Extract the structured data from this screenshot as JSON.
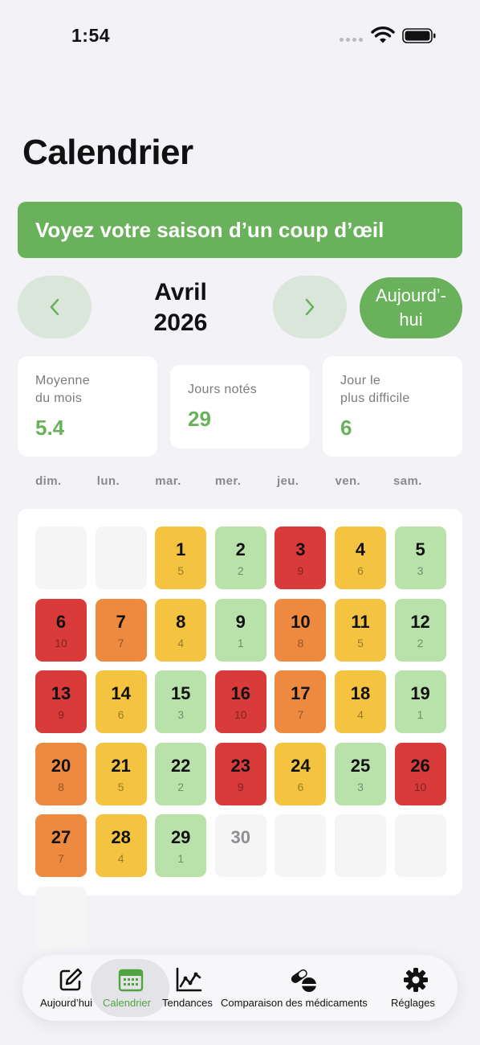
{
  "status": {
    "time": "1:54"
  },
  "title": "Calendrier",
  "banner": "Voyez votre saison d’un coup d’œil",
  "month": {
    "line1": "Avril",
    "line2": "2026"
  },
  "today_button": {
    "line1": "Aujourd’-",
    "line2": "hui"
  },
  "stats": {
    "avg": {
      "label1": "Moyenne",
      "label2": "du mois",
      "value": "5.4"
    },
    "days": {
      "label": "Jours notés",
      "value": "29"
    },
    "hard": {
      "label1": "Jour le",
      "label2": "plus difficile",
      "value": "6"
    }
  },
  "weekdays": [
    "dim.",
    "lun.",
    "mar.",
    "mer.",
    "jeu.",
    "ven.",
    "sam."
  ],
  "colors": {
    "green": "#69b15b",
    "severity_low": "#b9e2ab",
    "severity_mid": "#f4c440",
    "severity_high": "#ee8a3f",
    "severity_max": "#d83b39"
  },
  "calendar": {
    "leading_blanks": 2,
    "days": [
      {
        "day": "1",
        "score": "5",
        "level": "mid"
      },
      {
        "day": "2",
        "score": "2",
        "level": "low"
      },
      {
        "day": "3",
        "score": "9",
        "level": "max"
      },
      {
        "day": "4",
        "score": "6",
        "level": "mid"
      },
      {
        "day": "5",
        "score": "3",
        "level": "low"
      },
      {
        "day": "6",
        "score": "10",
        "level": "max"
      },
      {
        "day": "7",
        "score": "7",
        "level": "high"
      },
      {
        "day": "8",
        "score": "4",
        "level": "mid"
      },
      {
        "day": "9",
        "score": "1",
        "level": "low"
      },
      {
        "day": "10",
        "score": "8",
        "level": "high"
      },
      {
        "day": "11",
        "score": "5",
        "level": "mid"
      },
      {
        "day": "12",
        "score": "2",
        "level": "low"
      },
      {
        "day": "13",
        "score": "9",
        "level": "max"
      },
      {
        "day": "14",
        "score": "6",
        "level": "mid"
      },
      {
        "day": "15",
        "score": "3",
        "level": "low"
      },
      {
        "day": "16",
        "score": "10",
        "level": "max"
      },
      {
        "day": "17",
        "score": "7",
        "level": "high"
      },
      {
        "day": "18",
        "score": "4",
        "level": "mid"
      },
      {
        "day": "19",
        "score": "1",
        "level": "low"
      },
      {
        "day": "20",
        "score": "8",
        "level": "high"
      },
      {
        "day": "21",
        "score": "5",
        "level": "mid"
      },
      {
        "day": "22",
        "score": "2",
        "level": "low"
      },
      {
        "day": "23",
        "score": "9",
        "level": "max"
      },
      {
        "day": "24",
        "score": "6",
        "level": "mid"
      },
      {
        "day": "25",
        "score": "3",
        "level": "low"
      },
      {
        "day": "26",
        "score": "10",
        "level": "max"
      },
      {
        "day": "27",
        "score": "7",
        "level": "high"
      },
      {
        "day": "28",
        "score": "4",
        "level": "mid"
      },
      {
        "day": "29",
        "score": "1",
        "level": "low"
      },
      {
        "day": "30",
        "score": "",
        "level": "none"
      }
    ],
    "trailing_blanks": 4
  },
  "tabs": [
    {
      "label": "Aujourd’hui",
      "icon": "edit-icon"
    },
    {
      "label": "Calendrier",
      "icon": "calendar-icon",
      "active": true
    },
    {
      "label": "Tendances",
      "icon": "chart-icon"
    },
    {
      "label": "Comparaison des médicaments",
      "icon": "pills-icon"
    },
    {
      "label": "Réglages",
      "icon": "gear-icon"
    }
  ]
}
